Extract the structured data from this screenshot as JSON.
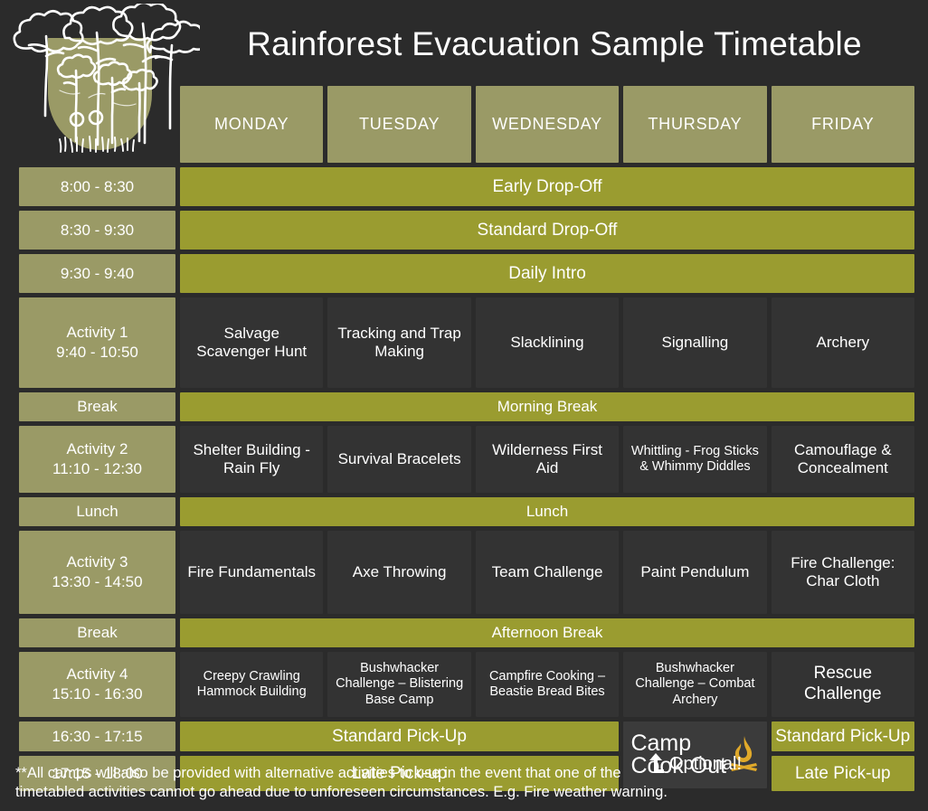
{
  "header": {
    "title": "Rainforest Evacuation Sample Timetable",
    "logo_name": "rainforest-trees-logo"
  },
  "colors": {
    "background": "#2b2b2b",
    "olive": "#9a9a66",
    "green": "#9a9c30",
    "dark_cell": "#333333",
    "cookout_cell": "#3b3b3b",
    "flame": "#e0a92a",
    "text": "#ffffff"
  },
  "days": [
    "MONDAY",
    "TUESDAY",
    "WEDNESDAY",
    "THURSDAY",
    "FRIDAY"
  ],
  "rows": [
    {
      "id": "early-drop-off",
      "time": "8:00 - 8:30",
      "type": "full",
      "label": "Early Drop-Off"
    },
    {
      "id": "standard-drop-off",
      "time": "8:30 - 9:30",
      "type": "full",
      "label": "Standard Drop-Off"
    },
    {
      "id": "daily-intro",
      "time": "9:30 - 9:40",
      "type": "full",
      "label": "Daily Intro"
    },
    {
      "id": "activity-1",
      "time_line1": "Activity 1",
      "time_line2": "9:40 - 10:50",
      "type": "days",
      "cells": [
        "Salvage Scavenger Hunt",
        "Tracking and Trap Making",
        "Slacklining",
        "Signalling",
        "Archery"
      ]
    },
    {
      "id": "morning-break",
      "time": "Break",
      "type": "full",
      "label": "Morning Break"
    },
    {
      "id": "activity-2",
      "time_line1": "Activity 2",
      "time_line2": "11:10 - 12:30",
      "type": "days",
      "cells": [
        "Shelter Building - Rain Fly",
        "Survival Bracelets",
        "Wilderness First Aid",
        "Whittling - Frog Sticks & Whimmy Diddles",
        "Camouflage & Concealment"
      ]
    },
    {
      "id": "lunch",
      "time": "Lunch",
      "type": "full",
      "label": "Lunch"
    },
    {
      "id": "activity-3",
      "time_line1": "Activity 3",
      "time_line2": "13:30 - 14:50",
      "type": "days",
      "cells": [
        "Fire Fundamentals",
        "Axe Throwing",
        "Team Challenge",
        "Paint Pendulum",
        "Fire Challenge: Char Cloth"
      ]
    },
    {
      "id": "afternoon-break",
      "time": "Break",
      "type": "full",
      "label": "Afternoon Break"
    },
    {
      "id": "activity-4",
      "time_line1": "Activity 4",
      "time_line2": "15:10 - 16:30",
      "type": "days",
      "cells": [
        "Creepy Crawling Hammock Building",
        "Bushwhacker Challenge – Blistering Base Camp",
        "Campfire Cooking – Beastie Bread Bites",
        "Bushwhacker Challenge – Combat Archery",
        "Rescue Challenge"
      ]
    }
  ],
  "pickup": {
    "standard": {
      "time": "16:30 - 17:15",
      "span_label": "Standard Pick-Up",
      "friday_label": "Standard Pick-Up"
    },
    "late": {
      "time": "17:15 - 18:00",
      "span_label": "Late Pick-up",
      "friday_label": "Late Pick-up"
    },
    "cookout": {
      "line1": "Camp",
      "line2": "Cook Out",
      "icon": "campfire-flame-icon"
    }
  },
  "optional": {
    "label": "Optional!",
    "icon": "corner-up-arrow-icon"
  },
  "footnote": {
    "text": "**All camps will also be provided with alternative activities to use in the event that one of the timetabled activities cannot go ahead due to unforeseen circumstances. E.g. Fire weather warning."
  }
}
